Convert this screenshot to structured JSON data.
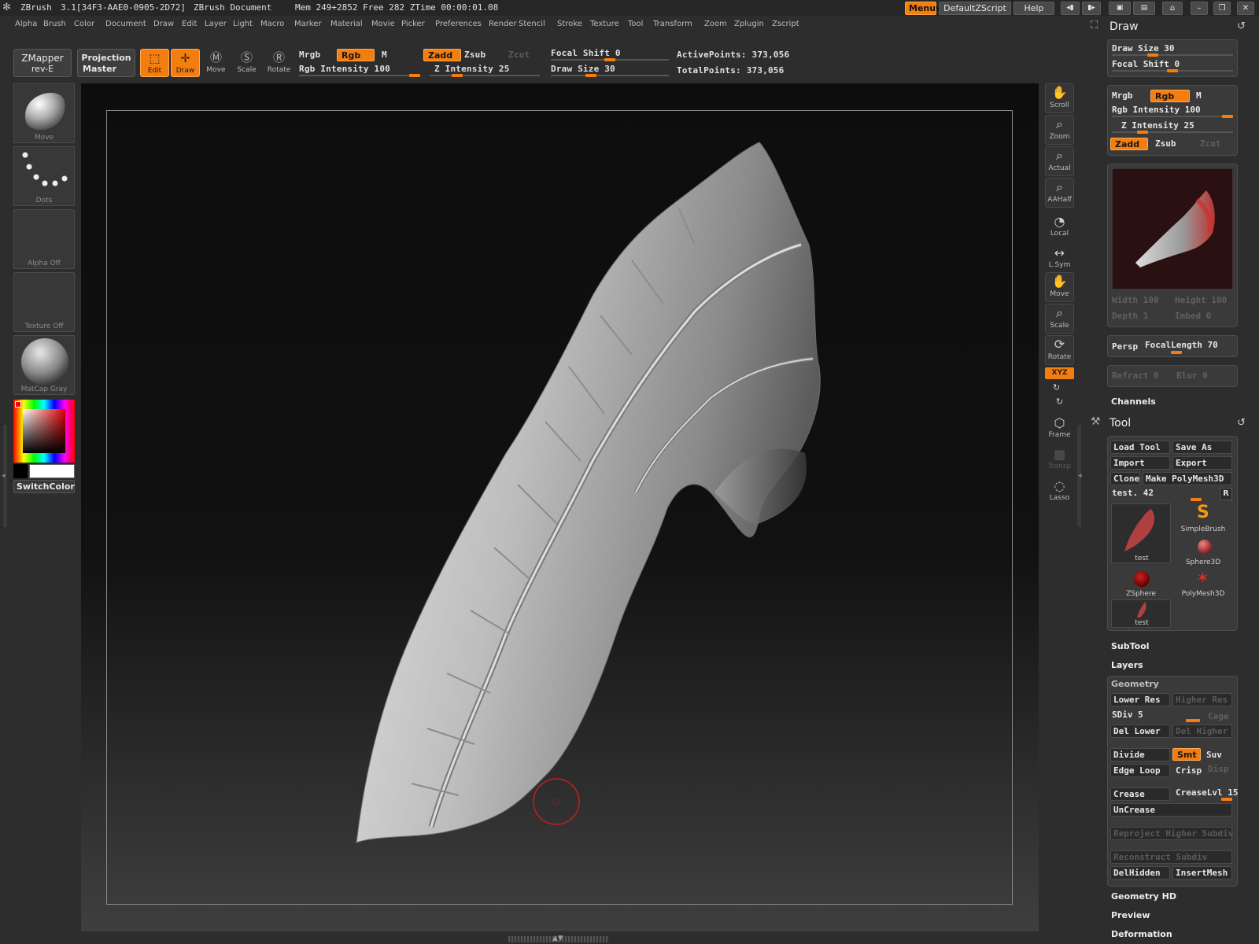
{
  "titlebar": {
    "app": "ZBrush",
    "version": "3.1[34F3-AAE0-0905-2D72]",
    "doc": "ZBrush Document",
    "mem": "Mem 249+2852  Free 282  ZTime 00:00:01.08",
    "menus_btn": "Menus",
    "script_btn": "DefaultZScript",
    "help_btn": "Help"
  },
  "menubar": [
    "Alpha",
    "Brush",
    "Color",
    "Document",
    "Draw",
    "Edit",
    "Layer",
    "Light",
    "Macro",
    "Marker",
    "Material",
    "Movie",
    "Picker",
    "Preferences",
    "Render",
    "Stencil",
    "Stroke",
    "Texture",
    "Tool",
    "Transform",
    "Zoom",
    "Zplugin",
    "Zscript"
  ],
  "toolbar": {
    "zmapper": "ZMapper",
    "zmapper_sub": "rev-E",
    "projection": "Projection",
    "projection_sub": "Master",
    "modes": [
      {
        "label": "Edit",
        "active": true
      },
      {
        "label": "Draw",
        "active": true
      },
      {
        "label": "Move",
        "active": false
      },
      {
        "label": "Scale",
        "active": false
      },
      {
        "label": "Rotate",
        "active": false
      }
    ],
    "mrgb": "Mrgb",
    "rgb": "Rgb",
    "m": "M",
    "rgb_intensity": "Rgb  Intensity 100",
    "zadd": "Zadd",
    "zsub": "Zsub",
    "zcut": "Zcut",
    "z_intensity": "Z  Intensity 25",
    "focal_shift": "Focal  Shift 0",
    "draw_size": "Draw  Size 30",
    "active_points": "ActivePoints: 373,056",
    "total_points": "TotalPoints: 373,056"
  },
  "left_shelf": {
    "brush": "Move",
    "stroke": "Dots",
    "alpha": "Alpha  Off",
    "texture": "Texture  Off",
    "material": "MatCap  Gray",
    "switch_color": "SwitchColor"
  },
  "right_shelf": [
    "Scroll",
    "Zoom",
    "Actual",
    "AAHalf",
    "Local",
    "L.Sym",
    "Move",
    "Scale",
    "Rotate",
    "XYZ",
    "Frame",
    "Transp",
    "Lasso"
  ],
  "draw_panel": {
    "title": "Draw",
    "draw_size": "Draw  Size 30",
    "focal_shift": "Focal  Shift 0",
    "mrgb": "Mrgb",
    "rgb": "Rgb",
    "m": "M",
    "rgb_intensity": "Rgb  Intensity 100",
    "z_intensity": "Z  Intensity 25",
    "zadd": "Zadd",
    "zsub": "Zsub",
    "zcut": "Zcut",
    "width": "Width 100",
    "height": "Height 100",
    "depth": "Depth 1",
    "imbed": "Imbed 0",
    "persp": "Persp",
    "focal_length": "FocalLength 70",
    "refract": "Refract 0",
    "blur": "Blur 0",
    "channels": "Channels"
  },
  "tool_panel": {
    "title": "Tool",
    "load_tool": "Load Tool",
    "save_as": "Save As",
    "import": "Import",
    "export": "Export",
    "clone": "Clone",
    "make_polymesh": "Make PolyMesh3D",
    "current": "test. 42",
    "r": "R",
    "thumbs": [
      "test",
      "SimpleBrush",
      "Sphere3D",
      "ZSphere",
      "PolyMesh3D",
      "test"
    ],
    "subtool": "SubTool",
    "layers": "Layers",
    "geometry": "Geometry",
    "lower_res": "Lower Res",
    "higher_res": "Higher Res",
    "sdiv": "SDiv 5",
    "cage": "Cage",
    "del_lower": "Del Lower",
    "del_higher": "Del Higher",
    "divide": "Divide",
    "smt": "Smt",
    "suv": "Suv",
    "edge_loop": "Edge Loop",
    "crisp": "Crisp",
    "disp": "Disp",
    "crease": "Crease",
    "crease_lvl": "CreaseLvl 15",
    "uncrease": "UnCrease",
    "reproject": "Reproject Higher Subdiv",
    "reconstruct": "Reconstruct Subdiv",
    "delhidden": "DelHidden",
    "insertmesh": "InsertMesh",
    "geometry_hd": "Geometry HD",
    "preview": "Preview",
    "deformation": "Deformation"
  },
  "colors": {
    "accent": "#f47d0f",
    "background": "#2d2d2d",
    "mesh": "#c8c8c8"
  }
}
